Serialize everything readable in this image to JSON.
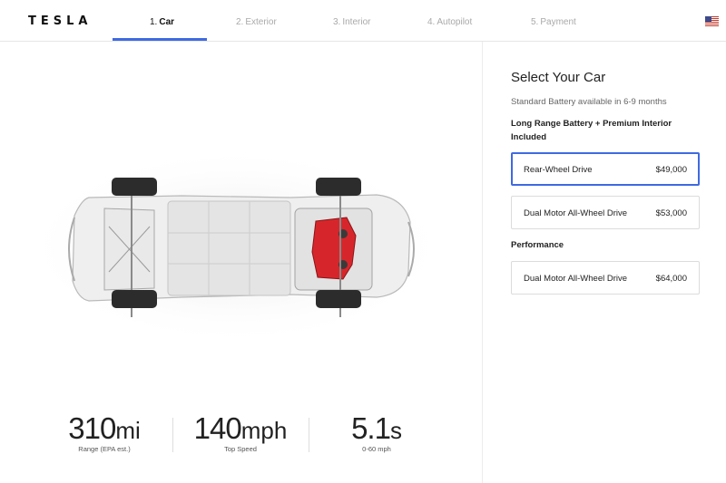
{
  "brand": "TESLA",
  "steps": [
    {
      "num": "1.",
      "label": "Car",
      "active": true
    },
    {
      "num": "2.",
      "label": "Exterior",
      "active": false
    },
    {
      "num": "3.",
      "label": "Interior",
      "active": false
    },
    {
      "num": "4.",
      "label": "Autopilot",
      "active": false
    },
    {
      "num": "5.",
      "label": "Payment",
      "active": false
    }
  ],
  "locale_icon": "us-flag-icon",
  "colors": {
    "accent": "#3e6ae1",
    "motor": "#d7262b"
  },
  "stats": [
    {
      "value": "310",
      "unit": "mi",
      "label": "Range (EPA est.)"
    },
    {
      "value": "140",
      "unit": "mph",
      "label": "Top Speed"
    },
    {
      "value": "5.1",
      "unit": "s",
      "label": "0-60 mph"
    }
  ],
  "panel": {
    "title": "Select Your Car",
    "availability": "Standard Battery available in 6-9 months",
    "groups": [
      {
        "heading": "Long Range Battery + Premium Interior Included",
        "options": [
          {
            "name": "Rear-Wheel Drive",
            "price": "$49,000",
            "selected": true
          },
          {
            "name": "Dual Motor All-Wheel Drive",
            "price": "$53,000",
            "selected": false
          }
        ]
      },
      {
        "heading": "Performance",
        "options": [
          {
            "name": "Dual Motor All-Wheel Drive",
            "price": "$64,000",
            "selected": false
          }
        ]
      }
    ]
  }
}
